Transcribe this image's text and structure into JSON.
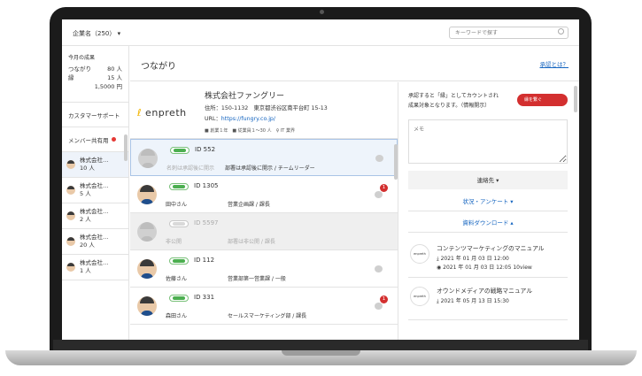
{
  "topbar": {
    "company_selector": "企業名（250） ▾",
    "search_placeholder": "キーワードで探す"
  },
  "sidebar": {
    "stats_title": "今月の成果",
    "tsunagari_label": "つながり",
    "tsunagari_value": "80 人",
    "en_label": "縁",
    "en_value": "15 人",
    "amount": "1,5000 円",
    "tab_support": "カスタマーサポート",
    "tab_members": "メンバー共有用",
    "groups": [
      {
        "name": "株式会社…",
        "count": "10 人"
      },
      {
        "name": "株式会社…",
        "count": "5 人"
      },
      {
        "name": "株式会社…",
        "count": "2 人"
      },
      {
        "name": "株式会社…",
        "count": "20 人"
      },
      {
        "name": "株式会社…",
        "count": "1 人"
      }
    ]
  },
  "main": {
    "title": "つながり",
    "help_link": "承認とは？"
  },
  "company": {
    "logo": "enpreth",
    "name": "株式会社ファングリー",
    "address": "住所：150-1132　東京都渋谷区南平台町 15-13",
    "url_label": "URL：",
    "url": "https://fungry.co.jp/",
    "meta": "■ 創業１年　■ 従業員１〜30 人　♀ IT 業界"
  },
  "people": [
    {
      "id": "ID 552",
      "name": "名刺は承認後に開示",
      "dept": "部署は承認後に開示 / チームリーダー"
    },
    {
      "id": "ID 1305",
      "name": "田中さん",
      "dept": "営業企画課 / 課長",
      "unread": "1"
    },
    {
      "id": "ID 5597",
      "name": "非公開",
      "dept": "部署は非公開 / 課長"
    },
    {
      "id": "ID 112",
      "name": "佐藤さん",
      "dept": "営業部第一営業課 / 一般"
    },
    {
      "id": "ID 331",
      "name": "森田さん",
      "dept": "セールスマーケティング部 / 課長",
      "unread": "1"
    }
  ],
  "right": {
    "note_line1": "承認すると「縁」としてカウントされ",
    "note_line2": "成果対象となります。（情報開示）",
    "open_button": "縁を繋ぐ",
    "memo_placeholder": "メモ",
    "contact": "連絡先 ▾",
    "status": "状況・アンケート ▾",
    "downloads": "資料ダウンロード ▴",
    "docs": [
      {
        "title": "コンテンツマーケティングのマニュアル",
        "date": "2021 年 01 月 03 日 12:00",
        "views_date": "2021 年 01 月 03 日 12:05",
        "views": "10view"
      },
      {
        "title": "オウンドメディアの戦略マニュアル",
        "date": "2021 年 05 月 13 日 15:30"
      }
    ]
  }
}
